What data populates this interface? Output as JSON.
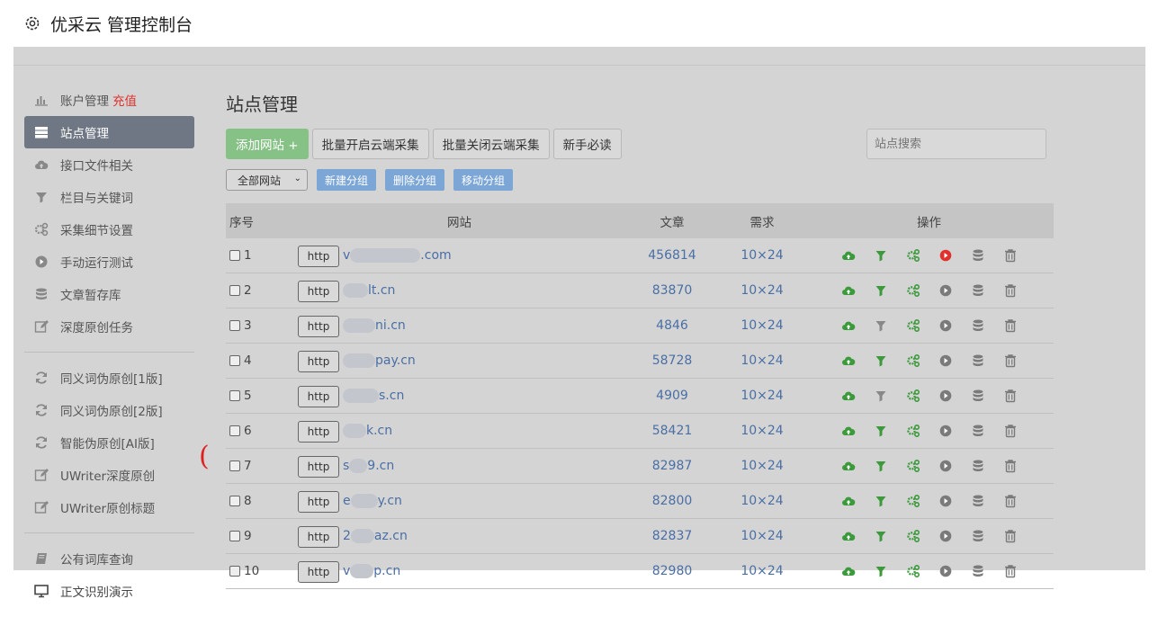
{
  "header": {
    "title": "优采云 管理控制台"
  },
  "sidebar": {
    "items": [
      {
        "label": "账户管理",
        "extra": "充值",
        "icon": "bar-chart-icon"
      },
      {
        "label": "站点管理",
        "icon": "server-icon",
        "active": true
      },
      {
        "label": "接口文件相关",
        "icon": "cloud-upload-icon"
      },
      {
        "label": "栏目与关键词",
        "icon": "filter-icon"
      },
      {
        "label": "采集细节设置",
        "icon": "gears-icon"
      },
      {
        "label": "手动运行测试",
        "icon": "play-circle-icon"
      },
      {
        "label": "文章暂存库",
        "icon": "database-icon"
      },
      {
        "label": "深度原创任务",
        "icon": "edit-icon"
      }
    ],
    "items2": [
      {
        "label": "同义词伪原创[1版]",
        "icon": "refresh-icon"
      },
      {
        "label": "同义词伪原创[2版]",
        "icon": "refresh-icon"
      },
      {
        "label": "智能伪原创[AI版]",
        "icon": "refresh-icon"
      },
      {
        "label": "UWriter深度原创",
        "icon": "edit-icon"
      },
      {
        "label": "UWriter原创标题",
        "icon": "edit-icon"
      }
    ],
    "items3": [
      {
        "label": "公有词库查询",
        "icon": "book-icon"
      },
      {
        "label": "正文识别演示",
        "icon": "monitor-icon"
      }
    ]
  },
  "main": {
    "title": "站点管理",
    "buttons": {
      "add": "添加网站 +",
      "enable": "批量开启云端采集",
      "disable": "批量关闭云端采集",
      "guide": "新手必读"
    },
    "search_placeholder": "站点搜索",
    "group_select": "全部网站",
    "group_buttons": {
      "new": "新建分组",
      "delete": "删除分组",
      "move": "移动分组"
    }
  },
  "table": {
    "headers": {
      "no": "序号",
      "site": "网站",
      "articles": "文章",
      "demand": "需求",
      "ops": "操作"
    },
    "rows": [
      {
        "no": "1",
        "protocol": "http",
        "pre": "v",
        "post": ".com",
        "articles": "456814",
        "demand": "10×24",
        "filter_active": true,
        "play_red": true
      },
      {
        "no": "2",
        "protocol": "http",
        "pre": "",
        "post": "lt.cn",
        "articles": "83870",
        "demand": "10×24",
        "filter_active": true,
        "play_red": false
      },
      {
        "no": "3",
        "protocol": "http",
        "pre": "",
        "post": "ni.cn",
        "articles": "4846",
        "demand": "10×24",
        "filter_active": false,
        "play_red": false
      },
      {
        "no": "4",
        "protocol": "http",
        "pre": "",
        "post": "pay.cn",
        "articles": "58728",
        "demand": "10×24",
        "filter_active": true,
        "play_red": false
      },
      {
        "no": "5",
        "protocol": "http",
        "pre": "",
        "post": "s.cn",
        "articles": "4909",
        "demand": "10×24",
        "filter_active": false,
        "play_red": false
      },
      {
        "no": "6",
        "protocol": "http",
        "pre": "",
        "post": "k.cn",
        "articles": "58421",
        "demand": "10×24",
        "filter_active": true,
        "play_red": false
      },
      {
        "no": "7",
        "protocol": "http",
        "pre": "s",
        "post": "9.cn",
        "articles": "82987",
        "demand": "10×24",
        "filter_active": true,
        "play_red": false
      },
      {
        "no": "8",
        "protocol": "http",
        "pre": "e",
        "post": "y.cn",
        "articles": "82800",
        "demand": "10×24",
        "filter_active": true,
        "play_red": false
      },
      {
        "no": "9",
        "protocol": "http",
        "pre": "2",
        "post": "az.cn",
        "articles": "82837",
        "demand": "10×24",
        "filter_active": true,
        "play_red": false
      },
      {
        "no": "10",
        "protocol": "http",
        "pre": "v",
        "post": "p.cn",
        "articles": "82980",
        "demand": "10×24",
        "filter_active": true,
        "play_red": false
      }
    ]
  },
  "colors": {
    "green": "#3c9a3c",
    "gray": "#888888",
    "red": "#e0322d",
    "link": "#4a6fa5"
  }
}
